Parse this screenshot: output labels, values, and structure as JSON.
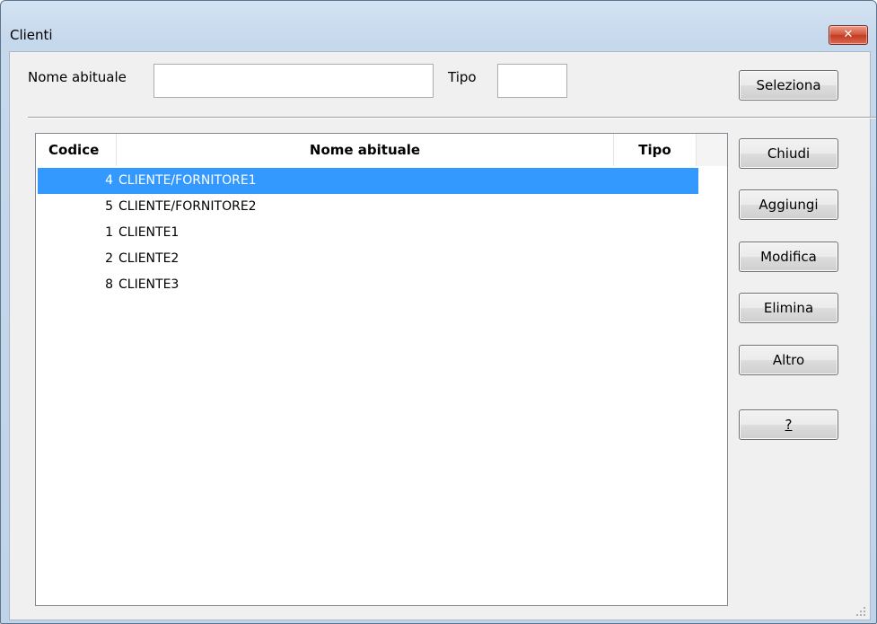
{
  "window": {
    "title": "Clienti",
    "close_glyph": "✕"
  },
  "filter": {
    "name_label": "Nome abituale",
    "name_value": "",
    "type_label": "Tipo",
    "type_value": ""
  },
  "buttons": {
    "select": "Seleziona",
    "close": "Chiudi",
    "add": "Aggiungi",
    "edit": "Modifica",
    "delete": "Elimina",
    "other": "Altro",
    "help": "?"
  },
  "table": {
    "headers": {
      "code": "Codice",
      "name": "Nome abituale",
      "type": "Tipo"
    },
    "rows": [
      {
        "code": "4",
        "name": "CLIENTE/FORNITORE1",
        "type": "",
        "selected": true
      },
      {
        "code": "5",
        "name": "CLIENTE/FORNITORE2",
        "type": ""
      },
      {
        "code": "1",
        "name": "CLIENTE1",
        "type": ""
      },
      {
        "code": "2",
        "name": "CLIENTE2",
        "type": ""
      },
      {
        "code": "8",
        "name": "CLIENTE3",
        "type": ""
      }
    ]
  },
  "colors": {
    "selection": "#3399ff",
    "frame": "#c6d8ec",
    "close_button": "#c33a20"
  }
}
